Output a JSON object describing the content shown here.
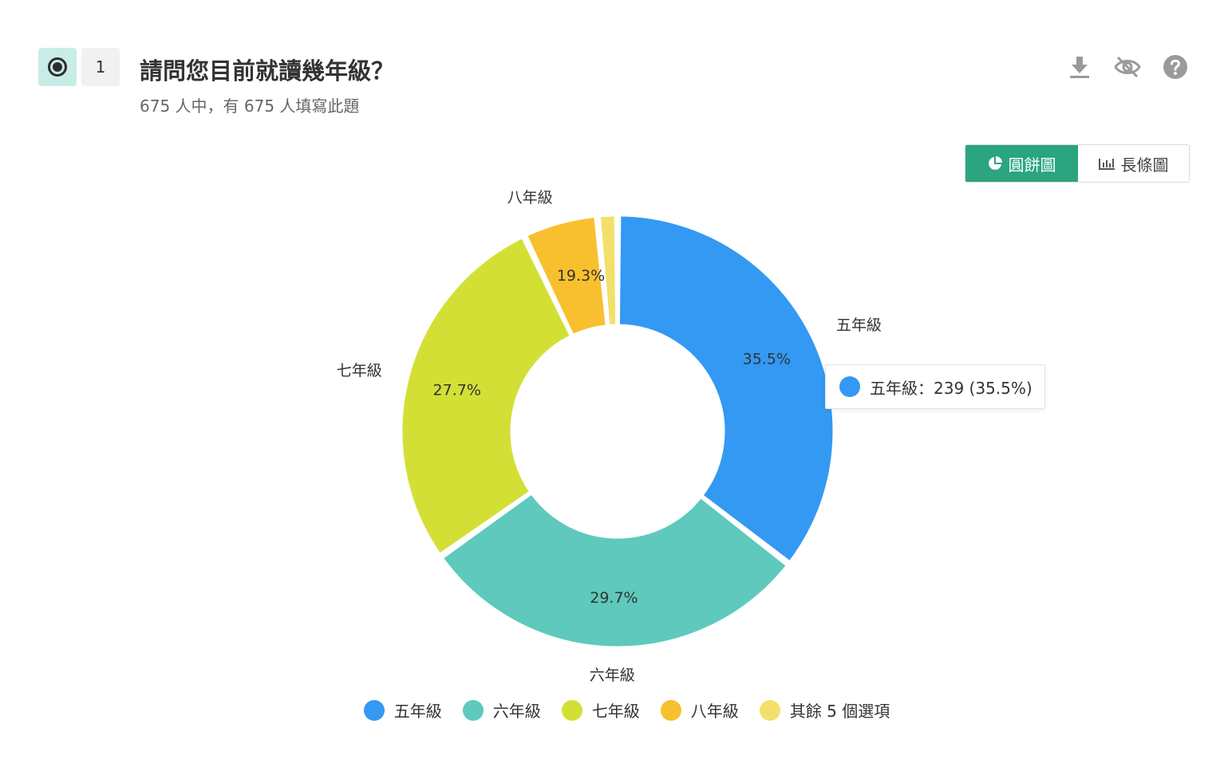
{
  "question": {
    "number": "1",
    "title": "請問您目前就讀幾年級？",
    "subtitle": "675 人中，有 675 人填寫此題"
  },
  "toolbar": {
    "icons": [
      "download-icon",
      "visibility-off-icon",
      "help-icon"
    ]
  },
  "view_toggle": {
    "pie_label": "圓餅圖",
    "bar_label": "長條圖",
    "active": "pie"
  },
  "tooltip": {
    "text": "五年級：239 (35.5%)",
    "color": "#3399f3"
  },
  "chart_data": {
    "type": "pie",
    "variant": "donut",
    "slices": [
      {
        "name": "五年級",
        "value": 35.5,
        "pct_label": "35.5%",
        "color": "#3399f3"
      },
      {
        "name": "六年級",
        "value": 29.7,
        "pct_label": "29.7%",
        "color": "#5ec9bc"
      },
      {
        "name": "七年級",
        "value": 27.7,
        "pct_label": "27.7%",
        "color": "#d4df35"
      },
      {
        "name": "八年級",
        "value": 5.6,
        "pct_label": "",
        "color": "#f8c02e"
      },
      {
        "name": "其餘 5 個選項",
        "value": 1.5,
        "pct_label": "",
        "color": "#f2e06a"
      }
    ],
    "outer_labels": [
      "五年級",
      "六年級",
      "七年級",
      "八年級",
      ""
    ],
    "floating_pct_label": "19.3%",
    "legend_position": "bottom",
    "legend": [
      "五年級",
      "六年級",
      "七年級",
      "八年級",
      "其餘 5 個選項"
    ]
  }
}
